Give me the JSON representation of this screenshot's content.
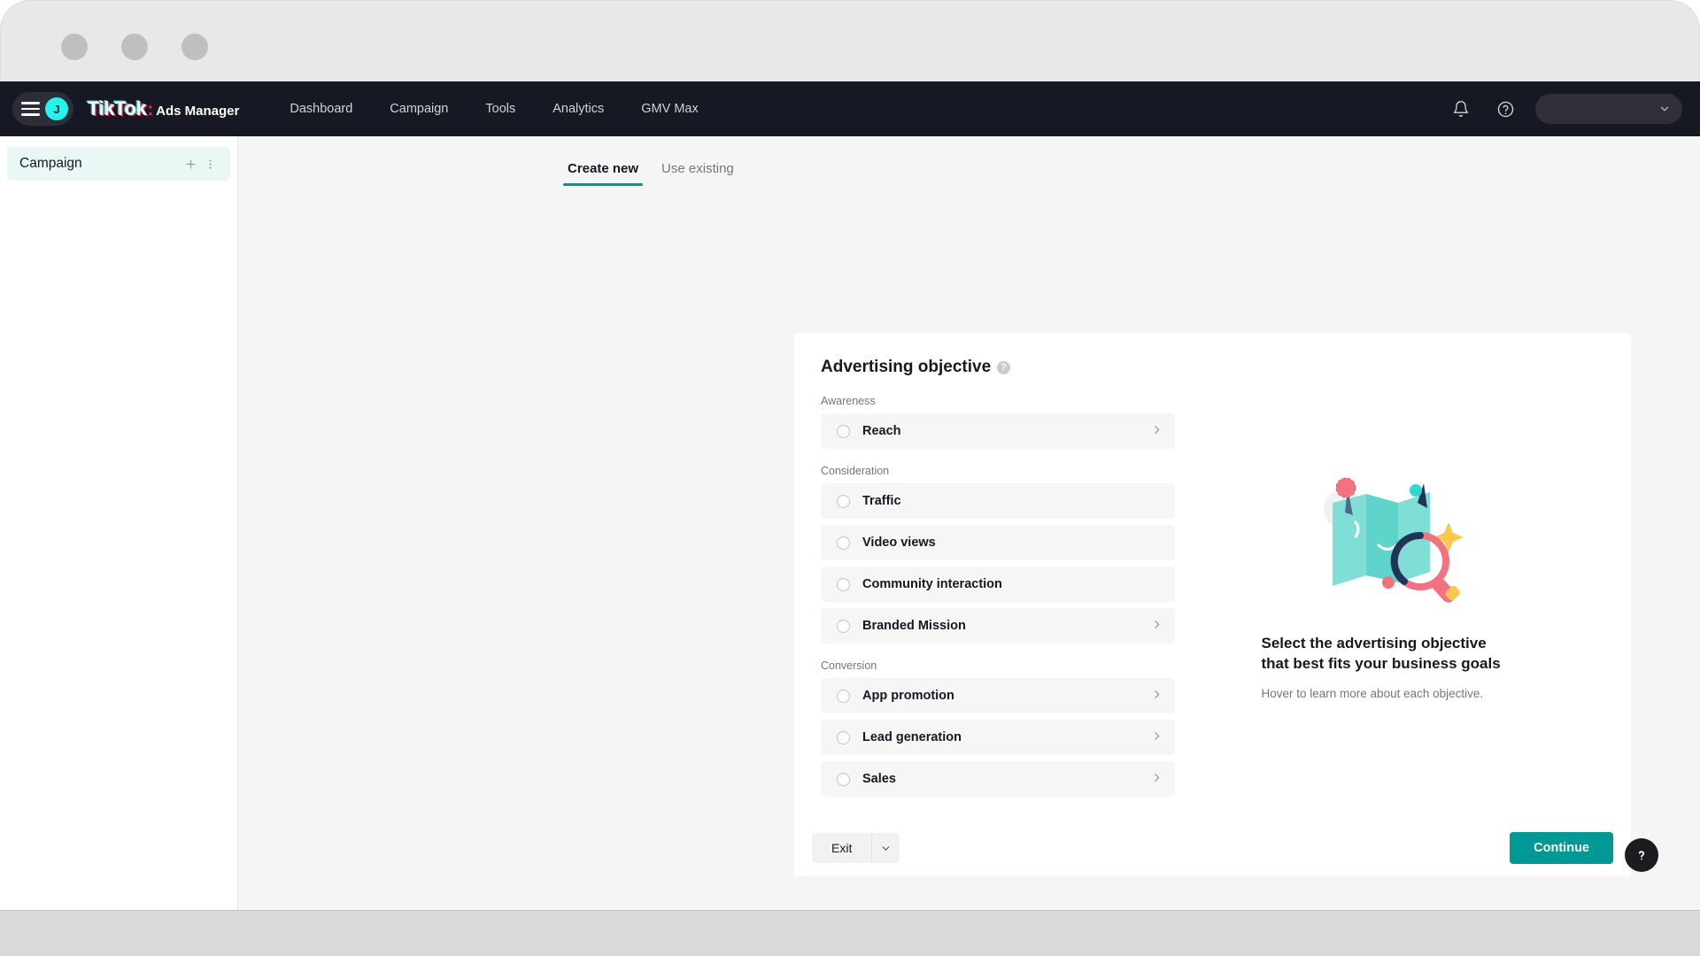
{
  "browser": {
    "traffic_lights": [
      "close",
      "minimize",
      "maximize"
    ]
  },
  "topnav": {
    "menu_icon": "hamburger-icon",
    "avatar_initial": "J",
    "brand_primary": "TikTok",
    "brand_separator": ":",
    "brand_secondary": "Ads Manager",
    "items": [
      {
        "label": "Dashboard"
      },
      {
        "label": "Campaign"
      },
      {
        "label": "Tools"
      },
      {
        "label": "Analytics"
      },
      {
        "label": "GMV Max"
      }
    ],
    "notification_icon": "bell-icon",
    "help_icon": "question-circle-icon",
    "account_selector_value": "",
    "account_selector_icon": "chevron-down-icon",
    "background_color": "#161823",
    "avatar_color": "#25f4ee"
  },
  "sidebar": {
    "campaign_label": "Campaign",
    "add_icon": "plus-icon",
    "more_icon": "more-vertical-icon",
    "active_background": "#e9f7f5"
  },
  "tabs": [
    {
      "label": "Create new",
      "active": true
    },
    {
      "label": "Use existing",
      "active": false
    }
  ],
  "card": {
    "title": "Advertising objective",
    "title_info_icon": "info-icon",
    "groups": [
      {
        "label": "Awareness",
        "options": [
          {
            "label": "Reach",
            "has_chevron": true,
            "selected": false
          }
        ]
      },
      {
        "label": "Consideration",
        "options": [
          {
            "label": "Traffic",
            "has_chevron": false,
            "selected": false
          },
          {
            "label": "Video views",
            "has_chevron": false,
            "selected": false
          },
          {
            "label": "Community interaction",
            "has_chevron": false,
            "selected": false
          },
          {
            "label": "Branded Mission",
            "has_chevron": true,
            "selected": false
          }
        ]
      },
      {
        "label": "Conversion",
        "options": [
          {
            "label": "App promotion",
            "has_chevron": true,
            "selected": false
          },
          {
            "label": "Lead generation",
            "has_chevron": true,
            "selected": false
          },
          {
            "label": "Sales",
            "has_chevron": true,
            "selected": false
          }
        ]
      }
    ],
    "right_panel": {
      "illustration": "map-magnifier-illustration",
      "headline": "Select the advertising objective that best fits your business goals",
      "subtext": "Hover to learn more about each objective."
    }
  },
  "footer": {
    "exit_label": "Exit",
    "exit_caret_icon": "chevron-down-icon",
    "continue_label": "Continue",
    "continue_color": "#009995"
  },
  "help_fab": {
    "icon": "question-mark-icon",
    "color": "#1b1b20"
  }
}
